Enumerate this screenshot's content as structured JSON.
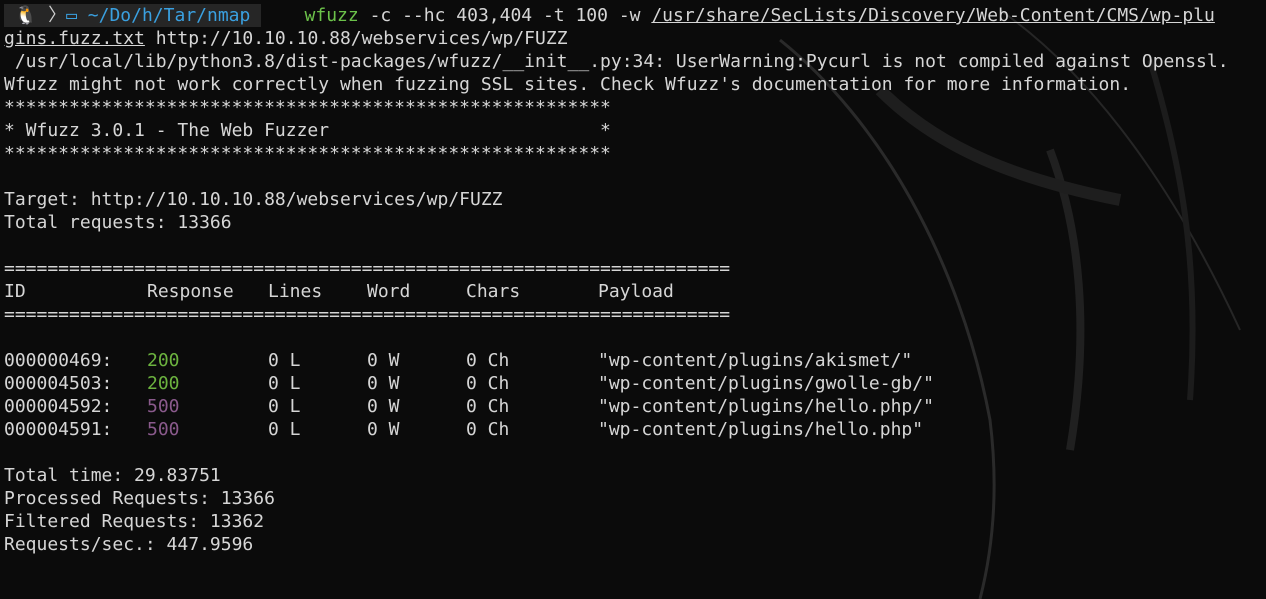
{
  "prompt": {
    "os_icon": "linux-icon",
    "folder_icon": "folder-icon",
    "path": "~/Do/h/Tar/nmap"
  },
  "command": {
    "name": "wfuzz",
    "args": " -c --hc 403,404 -t 100 -w ",
    "wordlist_part1": "/usr/share/SecLists/Discovery/Web-Content/CMS/wp-plu",
    "wordlist_part2": "gins.fuzz.txt",
    "url": " http://10.10.10.88/webservices/wp/FUZZ"
  },
  "warning": {
    "line1": " /usr/local/lib/python3.8/dist-packages/wfuzz/__init__.py:34: UserWarning:Pycurl is not compiled against Openssl.",
    "line2": "Wfuzz might not work correctly when fuzzing SSL sites. Check Wfuzz's documentation for more information."
  },
  "banner": {
    "stars": "********************************************************",
    "title": "* Wfuzz 3.0.1 - The Web Fuzzer                         *"
  },
  "target": "Target: http://10.10.10.88/webservices/wp/FUZZ",
  "total_requests": "Total requests: 13366",
  "separator": "===================================================================",
  "table": {
    "headers": {
      "id": "ID",
      "response": "Response",
      "lines": "Lines",
      "word": "Word",
      "chars": "Chars",
      "payload": "Payload"
    },
    "rows": [
      {
        "id": "000000469:",
        "response": "200",
        "lines": "0 L",
        "word": "0 W",
        "chars": "0 Ch",
        "payload": "\"wp-content/plugins/akismet/\""
      },
      {
        "id": "000004503:",
        "response": "200",
        "lines": "0 L",
        "word": "0 W",
        "chars": "0 Ch",
        "payload": "\"wp-content/plugins/gwolle-gb/\""
      },
      {
        "id": "000004592:",
        "response": "500",
        "lines": "0 L",
        "word": "0 W",
        "chars": "0 Ch",
        "payload": "\"wp-content/plugins/hello.php/\""
      },
      {
        "id": "000004591:",
        "response": "500",
        "lines": "0 L",
        "word": "0 W",
        "chars": "0 Ch",
        "payload": "\"wp-content/plugins/hello.php\""
      }
    ]
  },
  "summary": {
    "total_time": "Total time: 29.83751",
    "processed": "Processed Requests: 13366",
    "filtered": "Filtered Requests: 13362",
    "rate": "Requests/sec.: 447.9596"
  },
  "colors": {
    "background": "#0b0b0b",
    "text": "#d6d6d6",
    "path": "#3aa0e0",
    "command": "#6cc24a",
    "status_200": "#6cb33f",
    "status_500": "#8a5a8c"
  }
}
